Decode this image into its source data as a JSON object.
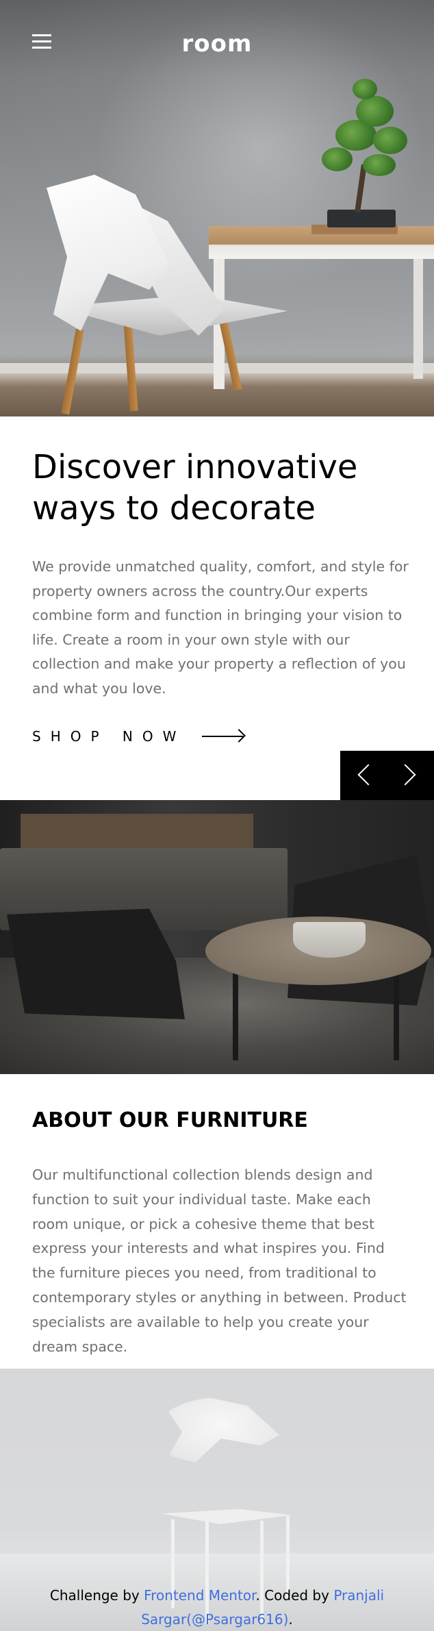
{
  "header": {
    "logo": "room",
    "menu_icon": "hamburger-menu-icon"
  },
  "hero": {
    "title": "Discover innovative ways to decorate",
    "description": "We provide unmatched quality, comfort, and style for property owners across the country.Our experts combine form and function in bringing your vision to life. Create a room in your own style with our collection and make your property a reflection of you and what you love.",
    "cta_label": "SHOP NOW",
    "cta_icon": "arrow-right-icon"
  },
  "slider": {
    "prev_icon": "chevron-left-icon",
    "next_icon": "chevron-right-icon"
  },
  "about": {
    "title": "ABOUT OUR FURNITURE",
    "description": "Our multifunctional collection blends design and function to suit your individual taste. Make each room unique, or pick a cohesive theme that best express your interests and what inspires you. Find the furniture pieces you need, from traditional to contemporary styles or anything in between. Product specialists are available to help you create your dream space."
  },
  "footer": {
    "prefix": "Challenge by ",
    "link1": "Frontend Mentor",
    "middle": ". Coded by ",
    "link2": "Pranjali Sargar(@Psargar616)",
    "suffix": "."
  },
  "colors": {
    "text": "#000000",
    "body_text": "#6f6f74",
    "link": "#3e6fe0",
    "control_bg": "#000000"
  }
}
